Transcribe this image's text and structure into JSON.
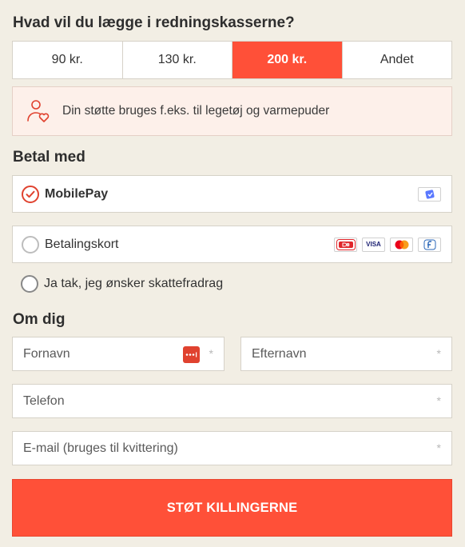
{
  "amount_section": {
    "heading": "Hvad vil du lægge i redningskasserne?",
    "options": [
      {
        "label": "90 kr.",
        "selected": false
      },
      {
        "label": "130 kr.",
        "selected": false
      },
      {
        "label": "200 kr.",
        "selected": true
      },
      {
        "label": "Andet",
        "selected": false
      }
    ],
    "info_icon": "person-heart-icon",
    "info_text": "Din støtte bruges f.eks. til legetøj og varmepuder"
  },
  "payment_section": {
    "heading": "Betal med",
    "methods": [
      {
        "label": "MobilePay",
        "selected": true,
        "logos": [
          "mobilepay-logo"
        ]
      },
      {
        "label": "Betalingskort",
        "selected": false,
        "logos": [
          "dankort-logo",
          "visa-logo",
          "mastercard-logo",
          "forbrugsforeningen-logo"
        ]
      }
    ],
    "tax_deduction_label": "Ja tak, jeg ønsker skattefradrag",
    "visa_text": "VISA"
  },
  "about_section": {
    "heading": "Om dig",
    "fields": {
      "first_name": {
        "placeholder": "Fornavn",
        "required_mark": "*"
      },
      "last_name": {
        "placeholder": "Efternavn",
        "required_mark": "*"
      },
      "phone": {
        "placeholder": "Telefon",
        "required_mark": "*"
      },
      "email": {
        "placeholder": "E-mail (bruges til kvittering)",
        "required_mark": "*"
      }
    }
  },
  "submit_label": "STØT KILLINGERNE",
  "colors": {
    "accent": "#ff5038",
    "background": "#f2eee4",
    "info_background": "#fdf0ea"
  }
}
